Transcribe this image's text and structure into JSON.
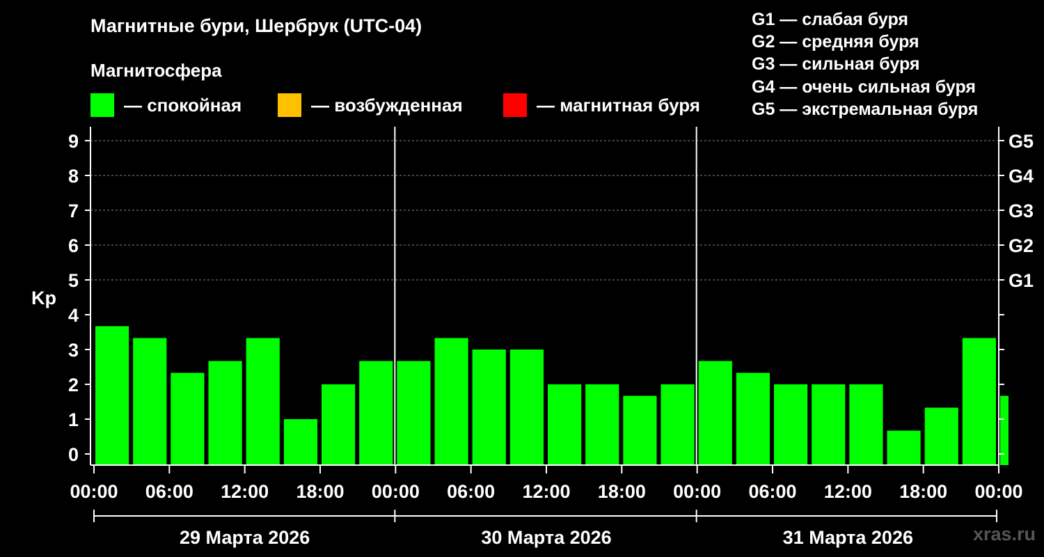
{
  "title": "Магнитные бури, Шербрук (UTC-04)",
  "subtitle": "Магнитосфера",
  "legend": [
    {
      "label": "— спокойная",
      "color": "#00ff00"
    },
    {
      "label": "— возбужденная",
      "color": "#ffc000"
    },
    {
      "label": "— магнитная буря",
      "color": "#ff0000"
    }
  ],
  "storm_scale": [
    "G1 — слабая буря",
    "G2 — средняя буря",
    "G3 — сильная буря",
    "G4 — очень сильная буря",
    "G5 — экстремальная буря"
  ],
  "watermark": "xras.ru",
  "chart_data": {
    "type": "bar",
    "ylabel": "Kp",
    "ylim": [
      0,
      9
    ],
    "yticks": [
      "0",
      "1",
      "2",
      "3",
      "4",
      "5",
      "6",
      "7",
      "8",
      "9"
    ],
    "right_labels": [
      {
        "y": 5,
        "label": "G1"
      },
      {
        "y": 6,
        "label": "G2"
      },
      {
        "y": 7,
        "label": "G3"
      },
      {
        "y": 8,
        "label": "G4"
      },
      {
        "y": 9,
        "label": "G5"
      }
    ],
    "xtick_labels": [
      "00:00",
      "06:00",
      "12:00",
      "18:00",
      "00:00",
      "06:00",
      "12:00",
      "18:00",
      "00:00",
      "06:00",
      "12:00",
      "18:00",
      "00:00"
    ],
    "days": [
      "29 Марта 2026",
      "30 Марта 2026",
      "31 Марта 2026"
    ],
    "bar_color": "#00ff00",
    "grid": true,
    "series": [
      {
        "values": [
          3.67,
          3.33,
          2.33,
          2.67,
          3.33,
          1.0,
          2.0,
          2.67,
          2.67,
          3.33,
          3.0,
          3.0,
          2.0,
          2.0,
          1.67,
          2.0,
          2.67,
          2.33,
          2.0,
          2.0,
          2.0,
          0.67,
          1.33,
          3.33,
          1.67
        ]
      }
    ]
  }
}
